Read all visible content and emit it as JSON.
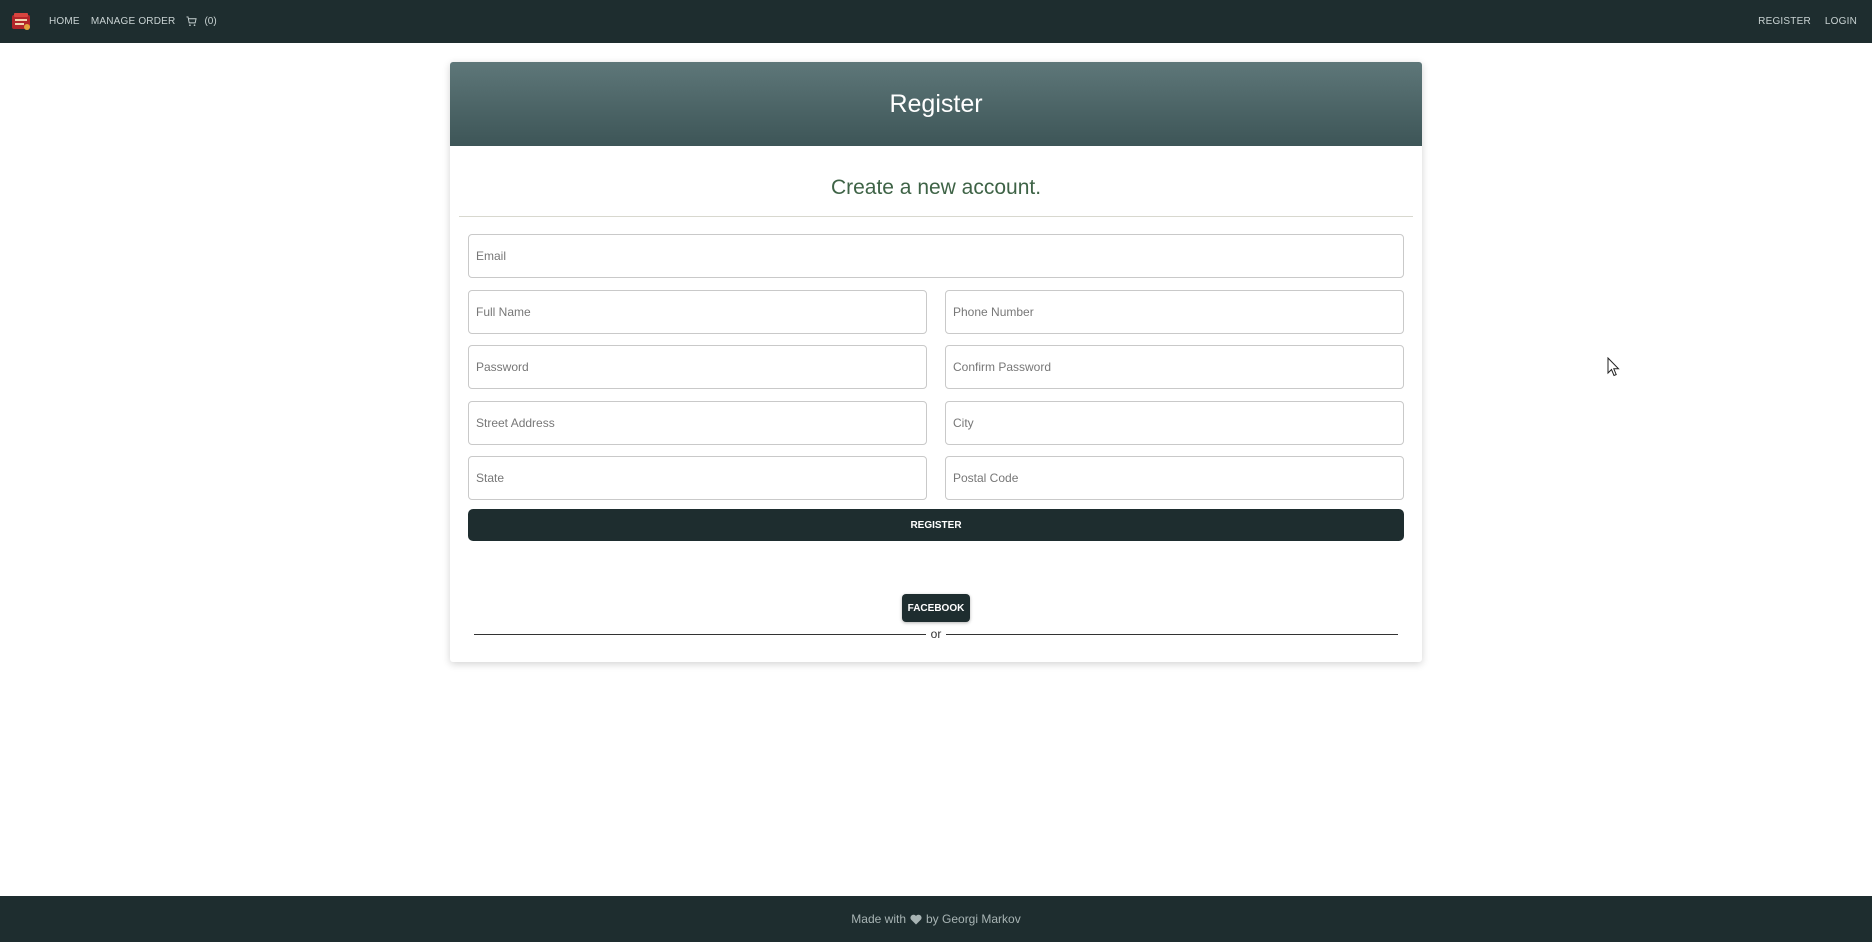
{
  "navbar": {
    "logo": "book-logo-icon",
    "links": [
      "HOME",
      "MANAGE ORDER"
    ],
    "cart_count": "(0)",
    "right_links": [
      "REGISTER",
      "LOGIN"
    ]
  },
  "card": {
    "title": "Register",
    "subtitle": "Create a new account."
  },
  "form": {
    "email_placeholder": "Email",
    "full_name_placeholder": "Full Name",
    "phone_placeholder": "Phone Number",
    "password_placeholder": "Password",
    "confirm_password_placeholder": "Confirm Password",
    "street_placeholder": "Street Address",
    "city_placeholder": "City",
    "state_placeholder": "State",
    "postal_placeholder": "Postal Code",
    "register_label": "REGISTER",
    "or_label": "or",
    "facebook_label": "FACEBOOK"
  },
  "footer": {
    "made_with": "Made with",
    "by": "by Georgi Markov"
  },
  "colors": {
    "navbar": "#1e2d2f",
    "header_gradient_top": "#5e7779",
    "header_gradient_bottom": "#3d5557",
    "subtitle": "#3e6346"
  }
}
